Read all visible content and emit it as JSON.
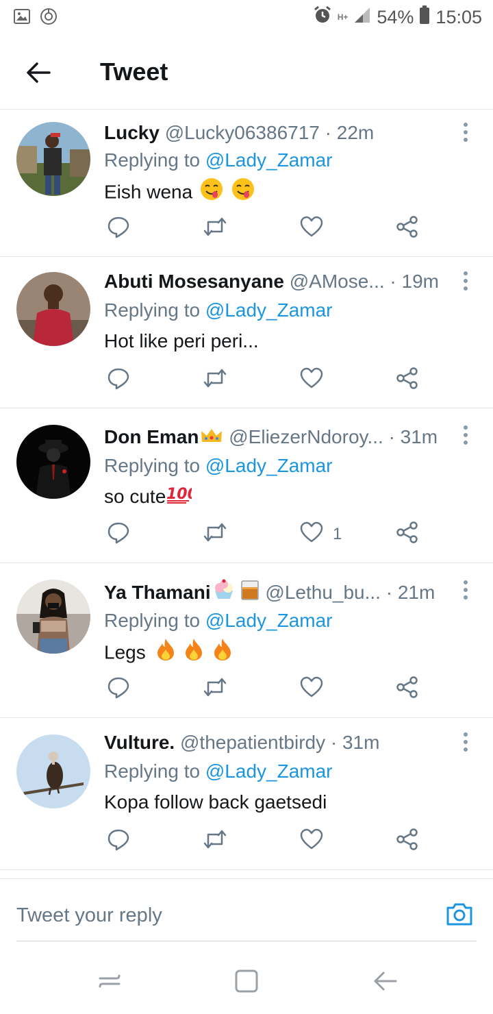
{
  "status_bar": {
    "network": "H+",
    "battery": "54%",
    "time": "15:05"
  },
  "header": {
    "title": "Tweet"
  },
  "tweets": [
    {
      "name": "Lucky",
      "handle": "@Lucky06386717",
      "time": "· 22m",
      "replying_prefix": "Replying to",
      "replying_to": "@Lady_Zamar",
      "text": "Eish wena",
      "emojis": [
        "yum-emoji",
        "yum-emoji"
      ],
      "like_count": ""
    },
    {
      "name": "Abuti Mosesanyane",
      "handle": "@AMose...",
      "time": "· 19m",
      "replying_prefix": "Replying to",
      "replying_to": "@Lady_Zamar",
      "text": "Hot like peri peri...",
      "emojis": [],
      "like_count": ""
    },
    {
      "name": "Don Eman",
      "handle": "@EliezerNdoroy...",
      "time": "· 31m",
      "replying_prefix": "Replying to",
      "replying_to": "@Lady_Zamar",
      "text": "so cute",
      "emojis": [
        "hundred-points-emoji"
      ],
      "name_emojis": [
        "crown-emoji"
      ],
      "like_count": "1"
    },
    {
      "name": "Ya Thamani",
      "handle": "@Lethu_bu...",
      "time": "· 21m",
      "replying_prefix": "Replying to",
      "replying_to": "@Lady_Zamar",
      "text": "Legs",
      "emojis": [
        "fire-emoji",
        "fire-emoji",
        "fire-emoji"
      ],
      "name_emojis": [
        "ice-cream-emoji",
        "whisky-glass-emoji"
      ],
      "like_count": ""
    },
    {
      "name": "Vulture.",
      "handle": "@thepatientbirdy",
      "time": "· 31m",
      "replying_prefix": "Replying to",
      "replying_to": "@Lady_Zamar",
      "text": "Kopa follow back gaetsedi",
      "emojis": [],
      "like_count": ""
    }
  ],
  "reply_bar": {
    "placeholder": "Tweet your reply"
  },
  "colors": {
    "link": "#1b95e0",
    "secondary_text": "#657786",
    "divider": "#e1e8ed"
  }
}
